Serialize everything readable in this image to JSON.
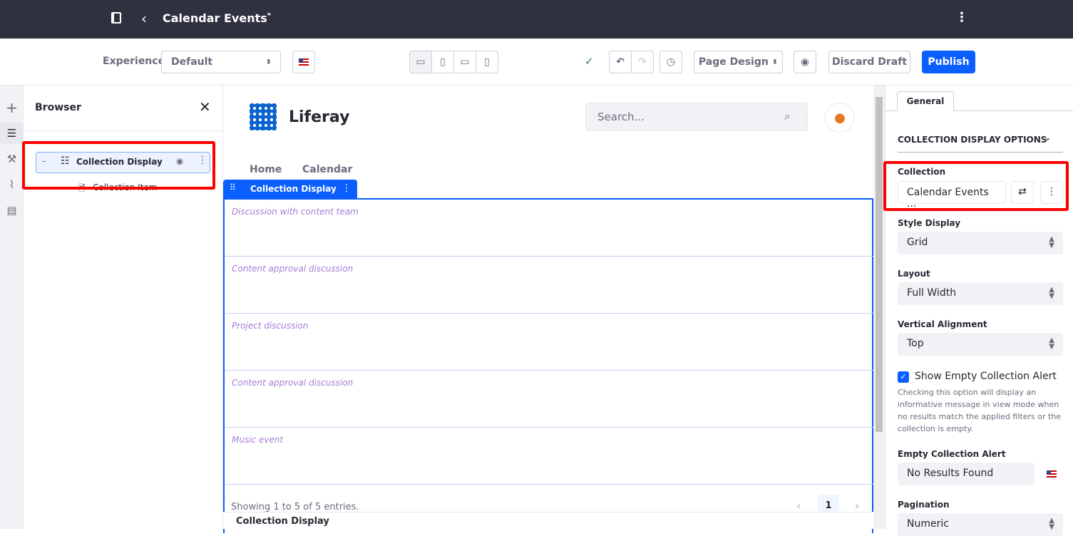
{
  "header": {
    "title": "Calendar Events",
    "modified_mark": "*"
  },
  "toolbar": {
    "experience_label": "Experience",
    "experience_value": "Default",
    "page_design": "Page Design",
    "discard_draft": "Discard Draft",
    "publish": "Publish"
  },
  "browser": {
    "title": "Browser",
    "tree": [
      {
        "label": "Collection Display"
      },
      {
        "label": "Collection Item"
      }
    ]
  },
  "site": {
    "name": "Liferay",
    "search_placeholder": "Search...",
    "nav": [
      "Home",
      "Calendar"
    ]
  },
  "fragment": {
    "label": "Collection Display",
    "items": [
      "Discussion with content team",
      "Content approval discussion",
      "Project discussion",
      "Content approval discussion",
      "Music event"
    ],
    "pagination_info": "Showing 1 to 5 of 5 entries.",
    "current_page": "1",
    "footer_label": "Collection Display"
  },
  "panel": {
    "tab": "General",
    "section": "COLLECTION DISPLAY OPTIONS",
    "collection_label": "Collection",
    "collection_value": "Calendar Events ...",
    "style_display_label": "Style Display",
    "style_display_value": "Grid",
    "layout_label": "Layout",
    "layout_value": "Full Width",
    "valign_label": "Vertical Alignment",
    "valign_value": "Top",
    "show_empty_label": "Show Empty Collection Alert",
    "show_empty_checked": true,
    "show_empty_help": "Checking this option will display an informative message in view mode when no results match the applied filters or the collection is empty.",
    "empty_alert_label": "Empty Collection Alert",
    "empty_alert_value": "No Results Found",
    "pagination_label": "Pagination",
    "pagination_value": "Numeric"
  },
  "colors": {
    "topbar": "#30313f",
    "primary": "#0b5fff",
    "highlight": "#ff0000",
    "item_text": "#a57ed6",
    "avatar": "#e87722"
  }
}
